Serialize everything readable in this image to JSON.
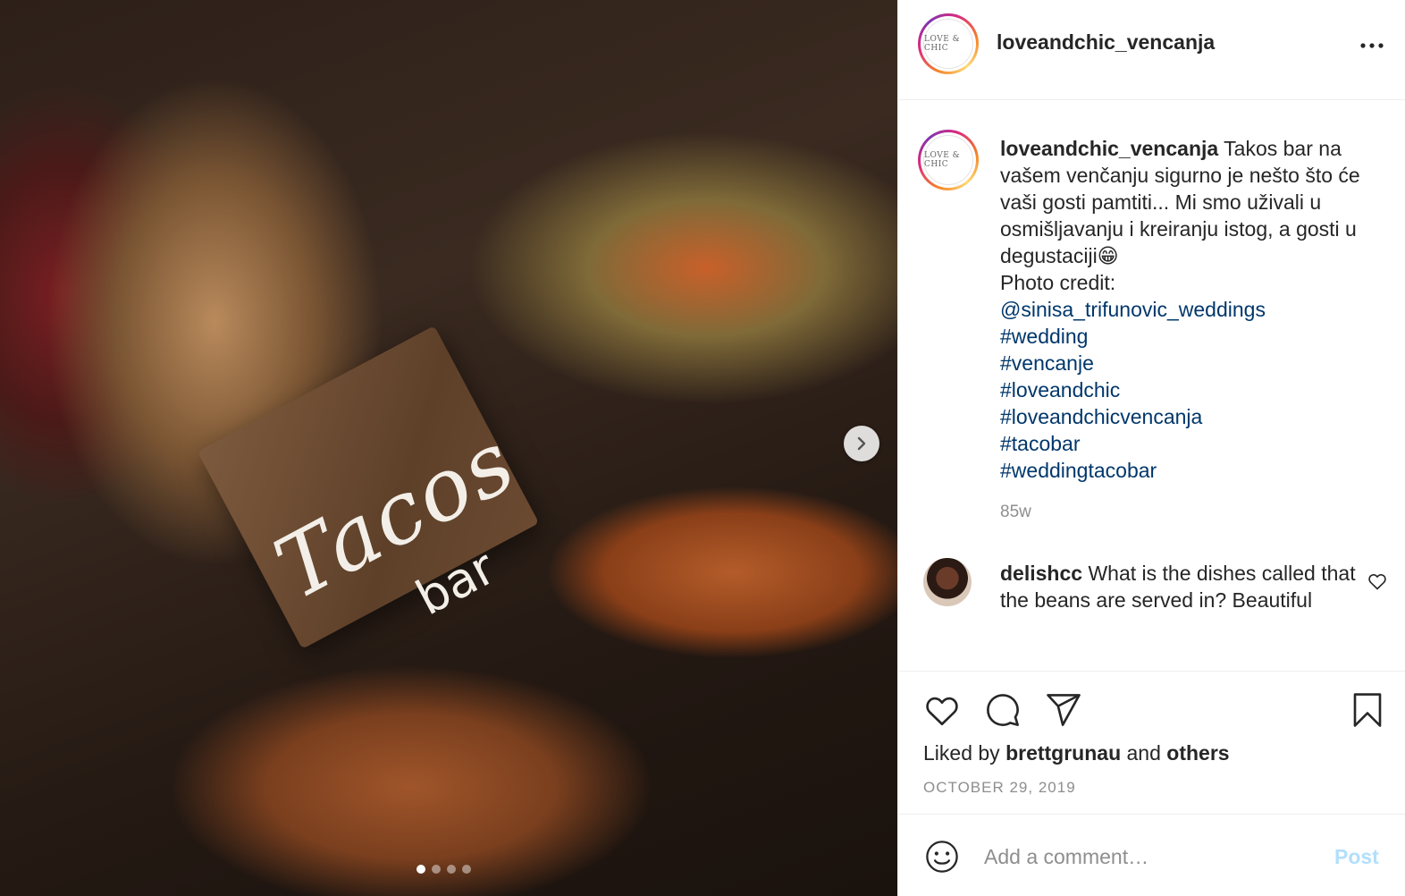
{
  "photo": {
    "sign_title": "Tacos",
    "sign_sub": "bar",
    "carousel": {
      "count": 4,
      "active": 0
    }
  },
  "post": {
    "username": "loveandchic_vencanja",
    "avatar_text": "LOVE & CHIC",
    "caption": {
      "username": "loveandchic_vencanja",
      "text": "Takos bar na vašem venčanju sigurno je nešto što će vaši gosti pamtiti... Mi smo uživali u osmišljavanju i kreiranju istog, a gosti u degustaciji😁",
      "photo_credit_label": "Photo credit:",
      "mention": "@sinisa_trifunovic_weddings",
      "hashtags": [
        "#wedding",
        "#vencanje",
        "#loveandchic",
        "#loveandchicvencanja",
        "#tacobar",
        "#weddingtacobar"
      ],
      "age": "85w"
    },
    "comment": {
      "username": "delishcc",
      "text": "What is the dishes called that the beans are served in? Beautiful"
    },
    "likes": {
      "prefix": "Liked by",
      "user": "brettgrunau",
      "joiner": "and",
      "others": "others"
    },
    "date": "OCTOBER 29, 2019",
    "add_comment": {
      "placeholder": "Add a comment…",
      "post_label": "Post"
    }
  },
  "icons": [
    "chevron-right-icon",
    "more-options-icon",
    "heart-icon",
    "comment-icon",
    "share-icon",
    "bookmark-icon",
    "emoji-icon"
  ],
  "colors": {
    "link": "#00376b",
    "muted": "#8e8e8e",
    "post_disabled": "#b2dffc",
    "text": "#262626"
  }
}
